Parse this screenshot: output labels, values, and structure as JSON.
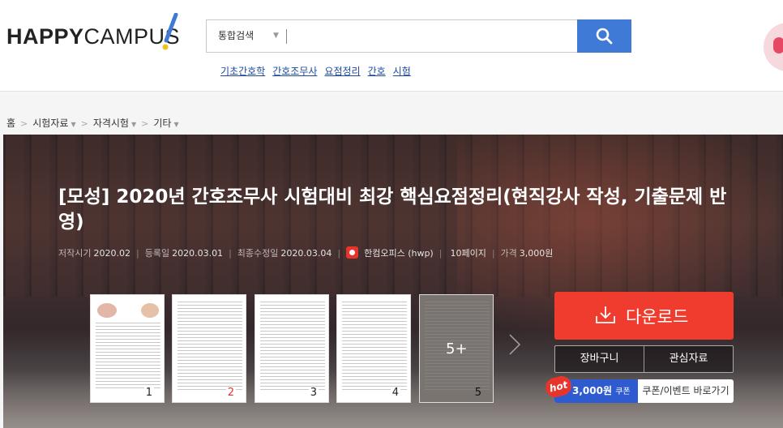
{
  "header": {
    "logo_bold": "HAPPY",
    "logo_thin": "CAMPUS",
    "search": {
      "scope": "통합검색",
      "value": "",
      "placeholder": ""
    },
    "keywords": [
      "기초간호학",
      "간호조무사",
      "요점정리",
      "간호",
      "시험"
    ]
  },
  "breadcrumb": [
    "홈",
    "시험자료",
    "자격시험",
    "기타"
  ],
  "document": {
    "title": "[모성] 2020년 간호조무사 시험대비 최강 핵심요점정리(현직강사 작성, 기출문제 반영)",
    "meta": {
      "written_label": "저작시기",
      "written": "2020.02",
      "registered_label": "등록일",
      "registered": "2020.03.01",
      "modified_label": "최종수정일",
      "modified": "2020.03.04",
      "format": "한컴오피스 (hwp)",
      "pages": "10페이지",
      "price_label": "가격",
      "price": "3,000원"
    },
    "thumbnails": [
      "1",
      "2",
      "3",
      "4",
      "5"
    ],
    "more_label": "5+"
  },
  "actions": {
    "download": "다운로드",
    "cart": "장바구니",
    "favorite": "관심자료",
    "hot": "hot",
    "coupon_amount": "3,000원",
    "coupon_unit": "쿠폰",
    "coupon_link": "쿠폰/이벤트 바로가기"
  },
  "colors": {
    "search_button": "#3f7bd6",
    "download_button": "#f03c2e",
    "coupon_blue": "#2f5bd0",
    "keyword_link": "#1d4aa0"
  }
}
